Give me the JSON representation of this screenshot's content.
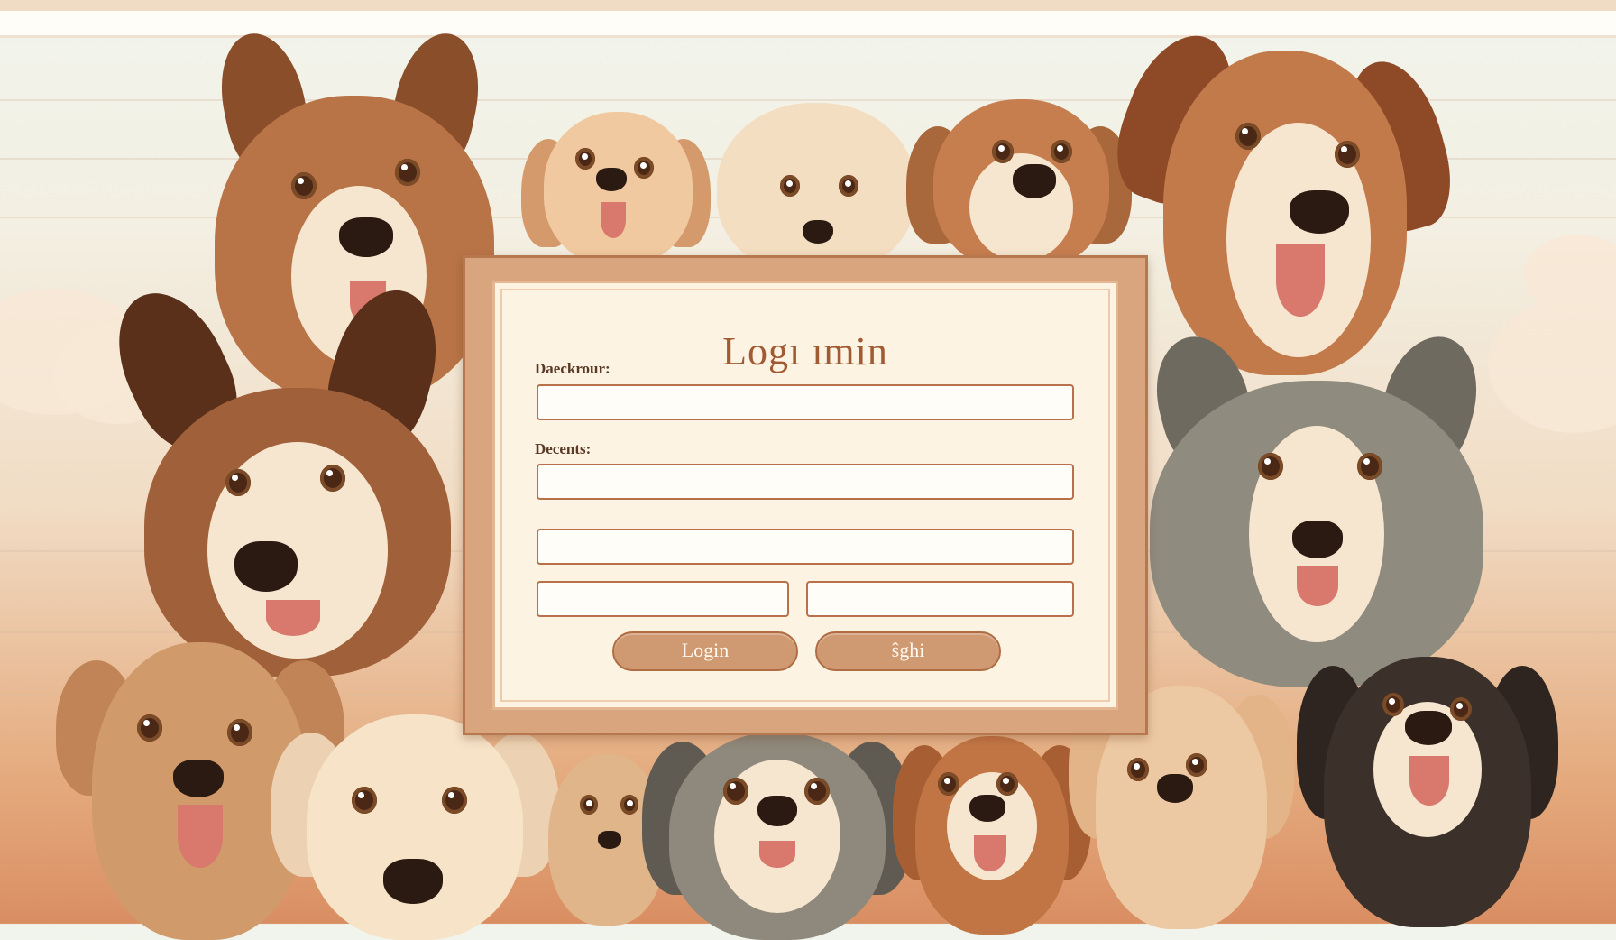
{
  "login": {
    "title": "Logı ımin",
    "label_1": "Daeckrour:",
    "label_2": "Decents:",
    "field_1_value": "",
    "field_2_value": "",
    "field_3_value": "",
    "field_4_value": "",
    "field_5_value": "",
    "login_button": "Login",
    "second_button": "ŝghi"
  },
  "colors": {
    "panel_frame": "#d8a57e",
    "panel_background": "#fdf3e3",
    "accent": "#a05b32",
    "button": "#cf9972"
  },
  "background": {
    "theme": "cartoon dogs illustration"
  }
}
